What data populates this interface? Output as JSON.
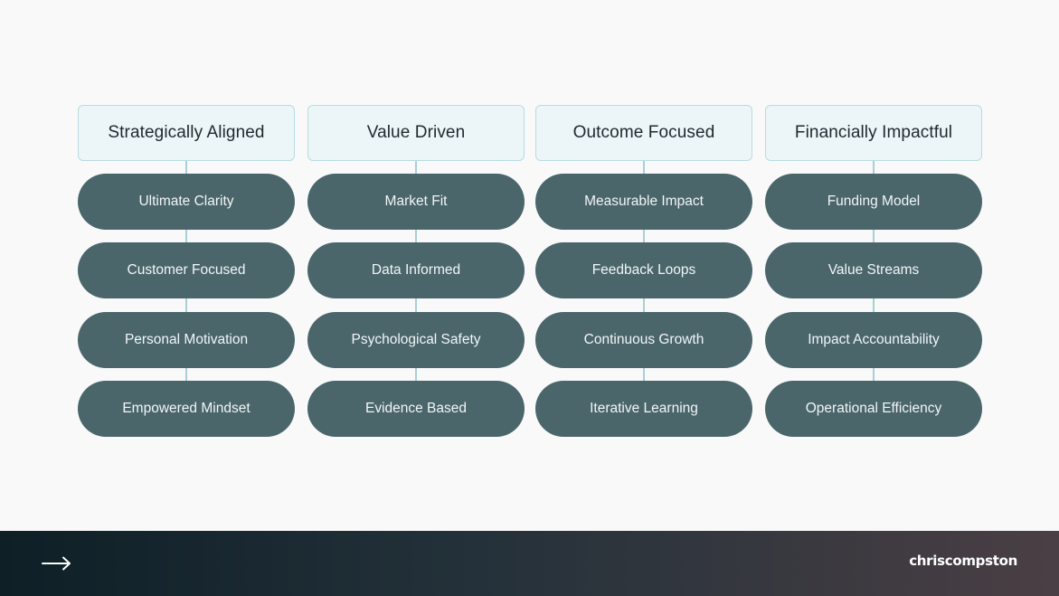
{
  "columns": [
    {
      "header": "Strategically Aligned",
      "items": [
        "Ultimate Clarity",
        "Customer Focused",
        "Personal Motivation",
        "Empowered Mindset"
      ]
    },
    {
      "header": "Value Driven",
      "items": [
        "Market Fit",
        "Data Informed",
        "Psychological Safety",
        "Evidence Based"
      ]
    },
    {
      "header": "Outcome Focused",
      "items": [
        "Measurable Impact",
        "Feedback Loops",
        "Continuous Growth",
        "Iterative Learning"
      ]
    },
    {
      "header": "Financially Impactful",
      "items": [
        "Funding Model",
        "Value Streams",
        "Impact Accountability",
        "Operational Efficiency"
      ]
    }
  ],
  "footer": {
    "brand": "chriscompston",
    "next_icon": "arrow-right-icon"
  },
  "colors": {
    "background": "#f9f9fa",
    "header_fill": "#ecf5f7",
    "header_border": "#b7dce2",
    "pill_fill": "#4a666b",
    "connector": "#a9cfd6",
    "footer_start": "#0e1f26",
    "footer_end": "#4a3f44"
  }
}
